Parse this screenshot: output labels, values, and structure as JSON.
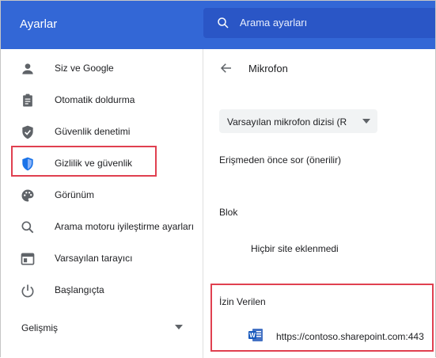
{
  "header": {
    "title": "Ayarlar",
    "search_placeholder": "Arama ayarları",
    "search_icon": "search-icon"
  },
  "sidebar": {
    "items": [
      {
        "label": "Siz ve Google",
        "icon": "person-icon"
      },
      {
        "label": "Otomatik doldurma",
        "icon": "clipboard-icon"
      },
      {
        "label": "Güvenlik denetimi",
        "icon": "shield-check-icon"
      },
      {
        "label": "Gizlilik ve güvenlik",
        "icon": "shield-privacy-icon"
      },
      {
        "label": "Görünüm",
        "icon": "palette-icon"
      },
      {
        "label": "Arama motoru iyileştirme ayarları",
        "icon": "search-icon"
      },
      {
        "label": "Varsayılan tarayıcı",
        "icon": "browser-icon"
      },
      {
        "label": "Başlangıçta",
        "icon": "power-icon"
      }
    ],
    "advanced_label": "Gelişmiş"
  },
  "main": {
    "title": "Mikrofon",
    "select_value": "Varsayılan mikrofon dizisi (R",
    "ask_label": "Erişmeden önce sor (önerilir)",
    "block_label": "Blok",
    "no_site_label": "Hiçbir site eklenmedi",
    "allowed_label": "İzin Verilen",
    "allowed_site": {
      "url": "https://contoso.sharepoint.com:443",
      "icon": "word-icon"
    }
  },
  "colors": {
    "header_bg": "#3367d6",
    "search_bg": "#2a56c6",
    "highlight": "#e04050",
    "active_icon": "#1a73e8"
  }
}
